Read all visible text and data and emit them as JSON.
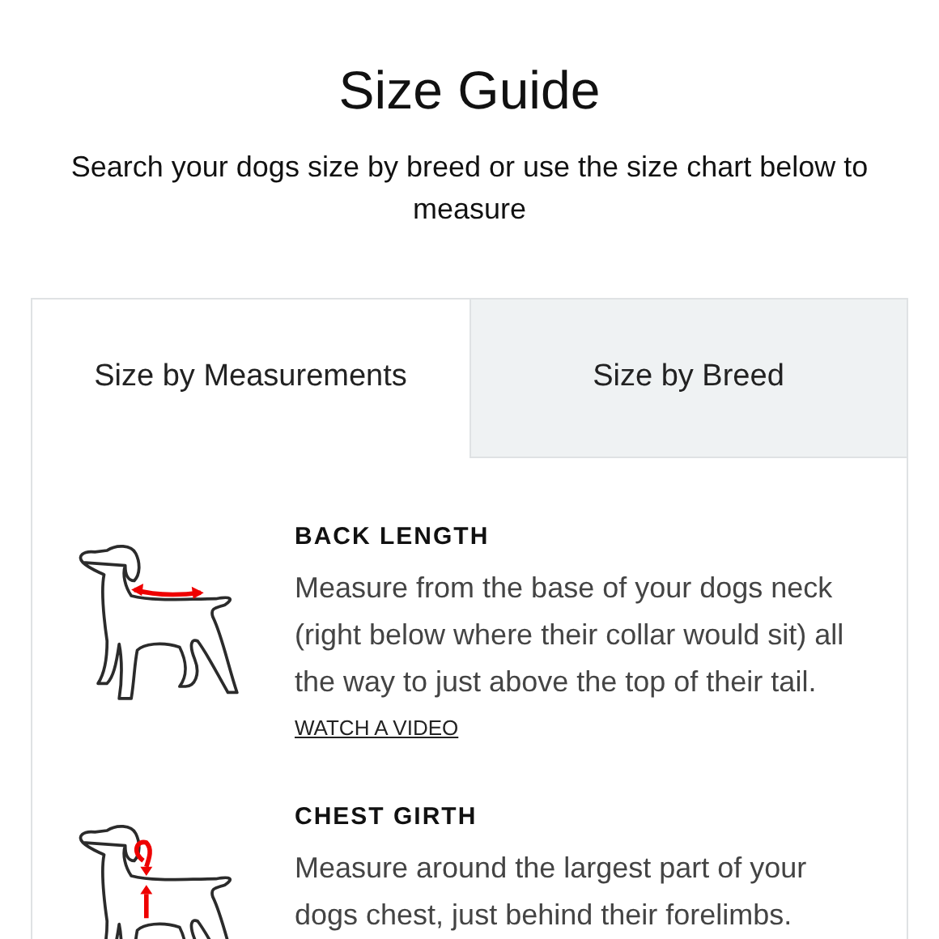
{
  "title": "Size Guide",
  "subtitle": "Search your dogs size by breed or use the size chart below to measure",
  "tabs": [
    {
      "label": "Size by Measurements",
      "selected": true
    },
    {
      "label": "Size by Breed",
      "selected": false
    }
  ],
  "measurements": [
    {
      "kind": "back",
      "title": "BACK LENGTH",
      "description": "Measure from the base of your dogs neck (right below where their collar would sit) all the way to just above the top of their tail.",
      "link": "WATCH A VIDEO"
    },
    {
      "kind": "chest",
      "title": "CHEST GIRTH",
      "description": "Measure around the largest part of your dogs chest, just behind their forelimbs."
    }
  ]
}
